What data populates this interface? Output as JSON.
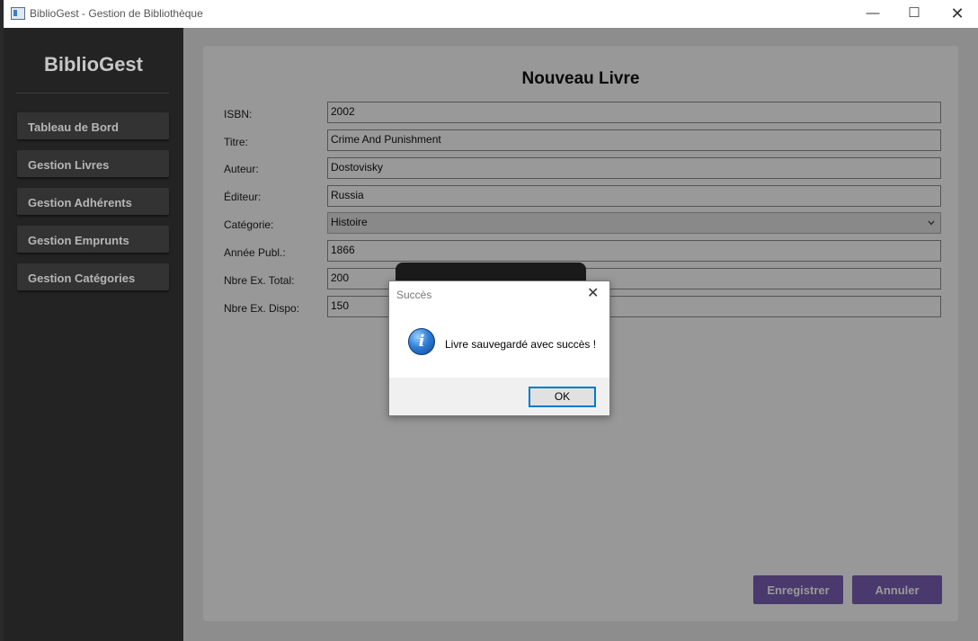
{
  "window": {
    "title": "BiblioGest - Gestion de Bibliothèque",
    "minimize": "—",
    "maximize": "☐",
    "close": "✕"
  },
  "sidebar": {
    "title": "BiblioGest",
    "items": [
      {
        "label": "Tableau de Bord"
      },
      {
        "label": "Gestion Livres"
      },
      {
        "label": "Gestion Adhérents"
      },
      {
        "label": "Gestion Emprunts"
      },
      {
        "label": "Gestion Catégories"
      }
    ]
  },
  "form": {
    "title": "Nouveau Livre",
    "fields": [
      {
        "label": "ISBN:",
        "value": "2002"
      },
      {
        "label": "Titre:",
        "value": "Crime And Punishment"
      },
      {
        "label": "Auteur:",
        "value": "Dostovisky"
      },
      {
        "label": "Éditeur:",
        "value": "Russia"
      },
      {
        "label": "Catégorie:",
        "value": "Histoire"
      },
      {
        "label": "Année Publ.:",
        "value": "1866"
      },
      {
        "label": "Nbre Ex. Total:",
        "value": "200"
      },
      {
        "label": "Nbre Ex. Dispo:",
        "value": "150"
      }
    ],
    "save_label": "Enregistrer",
    "cancel_label": "Annuler"
  },
  "dialog": {
    "title": "Succès",
    "message": "Livre sauvegardé avec succès !",
    "ok_label": "OK",
    "icon": "info-icon",
    "icon_glyph": "i",
    "close_glyph": "✕"
  },
  "colors": {
    "accent": "#7b5fb4",
    "sidebar_bg": "#232323",
    "sidebar_item": "#333333"
  }
}
